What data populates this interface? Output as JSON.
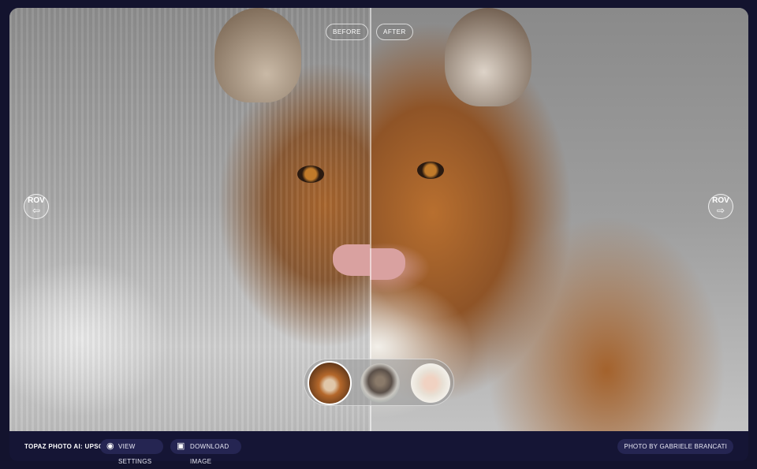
{
  "compare": {
    "before_label": "BEFORE",
    "after_label": "AFTER"
  },
  "nav": {
    "prev": {
      "caption": "ROV",
      "icon": "arrow-left-icon",
      "glyph": "⇦"
    },
    "next": {
      "caption": "ROV",
      "icon": "arrow-right-icon",
      "glyph": "⇨"
    }
  },
  "thumbnails": [
    {
      "subject": "tiger",
      "selected": true
    },
    {
      "subject": "deer",
      "selected": false
    },
    {
      "subject": "monkey",
      "selected": false
    }
  ],
  "footer": {
    "brand": "TOPAZ PHOTO AI: UPSCALE",
    "view_settings": {
      "label": "VIEW SETTINGS",
      "icon": "eye-icon",
      "glyph": "◉"
    },
    "download_image": {
      "label": "DOWNLOAD IMAGE",
      "icon": "image-icon",
      "glyph": "▣"
    },
    "credit": "PHOTO BY GABRIELE BRANCATI"
  },
  "colors": {
    "page_bg": "#13132e",
    "bar_bg": "#151535",
    "button_bg": "#252552"
  }
}
